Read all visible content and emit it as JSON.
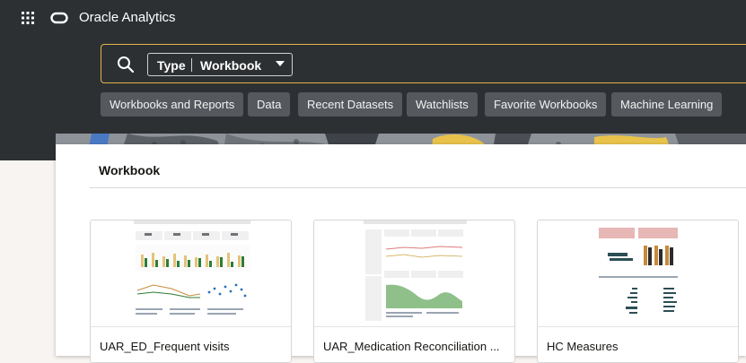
{
  "header": {
    "app_title": "Oracle Analytics",
    "apps_icon": "grid-icon",
    "logo_icon": "oracle-logo-icon"
  },
  "search": {
    "icon": "search-icon",
    "type_label": "Type",
    "type_value": "Workbook",
    "border_color": "#e0b44a"
  },
  "filters": [
    "Workbooks and Reports",
    "Data",
    "Recent Datasets",
    "Watchlists",
    "Favorite Workbooks",
    "Machine Learning"
  ],
  "main": {
    "section_title": "Workbook",
    "cards": [
      {
        "title": "UAR_ED_Frequent visits"
      },
      {
        "title": "UAR_Medication Reconciliation ..."
      },
      {
        "title": "HC Measures"
      }
    ]
  },
  "colors": {
    "topbar": "#2d3033",
    "chip_bg": "#55595e",
    "accent": "#e0b44a"
  }
}
